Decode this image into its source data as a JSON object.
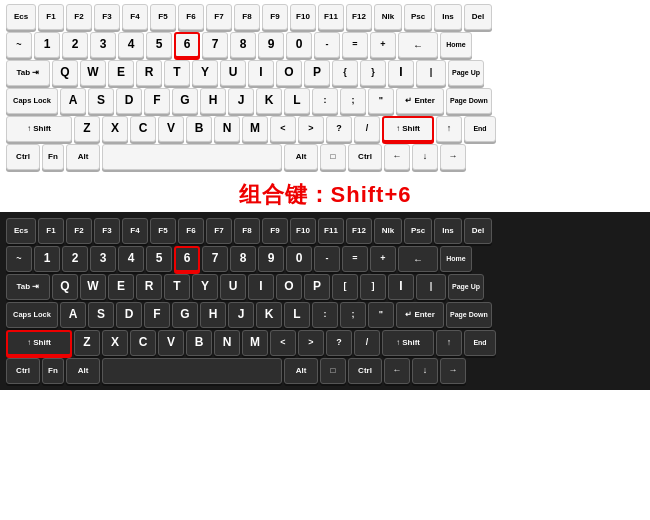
{
  "combo_label": "组合键：Shift+6",
  "keyboards": [
    {
      "type": "light",
      "rows": [
        [
          "Ecs",
          "F1",
          "F2",
          "F3",
          "F4",
          "F5",
          "F6",
          "F7",
          "F8",
          "F9",
          "F10",
          "F11",
          "F12",
          "Nlk",
          "Psc",
          "Ins",
          "Del"
        ],
        [
          "~",
          "1",
          "2",
          "3",
          "4",
          "5",
          "6",
          "7",
          "8",
          "9",
          "0",
          "-",
          "=",
          "+",
          "←",
          "Home"
        ],
        [
          "Tab",
          "Q",
          "W",
          "E",
          "R",
          "T",
          "Y",
          "U",
          "I",
          "O",
          "P",
          "{",
          "}",
          "I",
          "|",
          "Page Up"
        ],
        [
          "Caps Lock",
          "A",
          "S",
          "D",
          "F",
          "G",
          "H",
          "J",
          "K",
          "L",
          ":",
          ";",
          "\"",
          "↵ Enter",
          "Page Down"
        ],
        [
          "↑ Shift",
          "Z",
          "X",
          "C",
          "V",
          "B",
          "N",
          "M",
          "<",
          ">",
          "?",
          "/",
          "↑ Shift",
          "↑",
          "End"
        ],
        [
          "Ctrl",
          "Fn",
          "Alt",
          "",
          "Alt",
          "□",
          "Ctrl",
          "←",
          "↓",
          "→"
        ]
      ]
    },
    {
      "type": "dark",
      "rows": [
        [
          "Ecs",
          "F1",
          "F2",
          "F3",
          "F4",
          "F5",
          "F6",
          "F7",
          "F8",
          "F9",
          "F10",
          "F11",
          "F12",
          "Nlk",
          "Psc",
          "Ins",
          "Del"
        ],
        [
          "~",
          "1",
          "2",
          "3",
          "4",
          "5",
          "6",
          "7",
          "8",
          "9",
          "0",
          "-",
          "=",
          "+",
          "←",
          "Home"
        ],
        [
          "Tab",
          "Q",
          "W",
          "E",
          "R",
          "T",
          "Y",
          "U",
          "I",
          "O",
          "P",
          "[",
          "]",
          "I",
          "|",
          "Page Up"
        ],
        [
          "Caps Lock",
          "A",
          "S",
          "D",
          "F",
          "G",
          "H",
          "J",
          "K",
          "L",
          ":",
          ";",
          "\"",
          "↵ Enter",
          "Page Down"
        ],
        [
          "↑ Shift",
          "Z",
          "X",
          "C",
          "V",
          "B",
          "N",
          "M",
          "<",
          ">",
          "?",
          "/",
          "↑ Shift",
          "↑",
          "End"
        ],
        [
          "Ctrl",
          "Fn",
          "Alt",
          "",
          "Alt",
          "□",
          "Ctrl",
          "←",
          "↓",
          "→"
        ]
      ]
    }
  ]
}
